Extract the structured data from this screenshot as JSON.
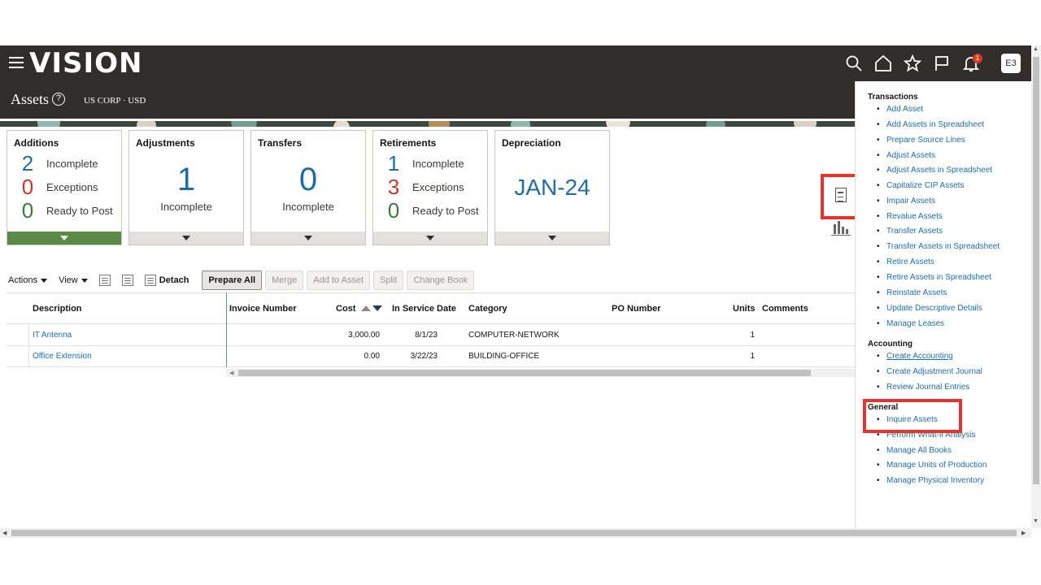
{
  "header": {
    "logo": "VISION",
    "notification_count": "1",
    "user_initials": "E3"
  },
  "subheader": {
    "title": "Assets",
    "org": "US CORP · USD"
  },
  "tiles": {
    "additions": {
      "title": "Additions",
      "rows": [
        {
          "num": "2",
          "label": "Incomplete"
        },
        {
          "num": "0",
          "label": "Exceptions"
        },
        {
          "num": "0",
          "label": "Ready to Post"
        }
      ]
    },
    "adjustments": {
      "title": "Adjustments",
      "num": "1",
      "label": "Incomplete"
    },
    "transfers": {
      "title": "Transfers",
      "num": "0",
      "label": "Incomplete"
    },
    "retirements": {
      "title": "Retirements",
      "rows": [
        {
          "num": "1",
          "label": "Incomplete"
        },
        {
          "num": "3",
          "label": "Exceptions"
        },
        {
          "num": "0",
          "label": "Ready to Post"
        }
      ]
    },
    "depreciation": {
      "title": "Depreciation",
      "period": "JAN-24"
    }
  },
  "toolbar": {
    "actions": "Actions",
    "view": "View",
    "detach": "Detach",
    "prepare_all": "Prepare All",
    "merge": "Merge",
    "add_to_asset": "Add to Asset",
    "split": "Split",
    "change_book": "Change Book"
  },
  "table": {
    "columns": {
      "description": "Description",
      "invoice": "Invoice Number",
      "cost": "Cost",
      "in_service": "In Service Date",
      "category": "Category",
      "po": "PO Number",
      "units": "Units",
      "comments": "Comments"
    },
    "rows": [
      {
        "description": "IT Antenna",
        "cost": "3,000.00",
        "date": "8/1/23",
        "category": "COMPUTER-NETWORK",
        "units": "1"
      },
      {
        "description": "Office Extension",
        "cost": "0.00",
        "date": "3/22/23",
        "category": "BUILDING-OFFICE",
        "units": "1"
      }
    ]
  },
  "tasks": {
    "transactions_title": "Transactions",
    "transactions": [
      "Add Asset",
      "Add Assets in Spreadsheet",
      "Prepare Source Lines",
      "Adjust Assets",
      "Adjust Assets in Spreadsheet",
      "Capitalize CIP Assets",
      "Impair Assets",
      "Revalue Assets",
      "Transfer Assets",
      "Transfer Assets in Spreadsheet",
      "Retire Assets",
      "Retire Assets in Spreadsheet",
      "Reinstate Assets",
      "Update Descriptive Details",
      "Manage Leases"
    ],
    "accounting_title": "Accounting",
    "accounting": [
      "Create Accounting",
      "Create Adjustment Journal",
      "Review Journal Entries"
    ],
    "general_title": "General",
    "general": [
      "Inquire Assets",
      "Perform What-if Analysis",
      "Manage All Books",
      "Manage Units of Production",
      "Manage Physical Inventory"
    ]
  }
}
